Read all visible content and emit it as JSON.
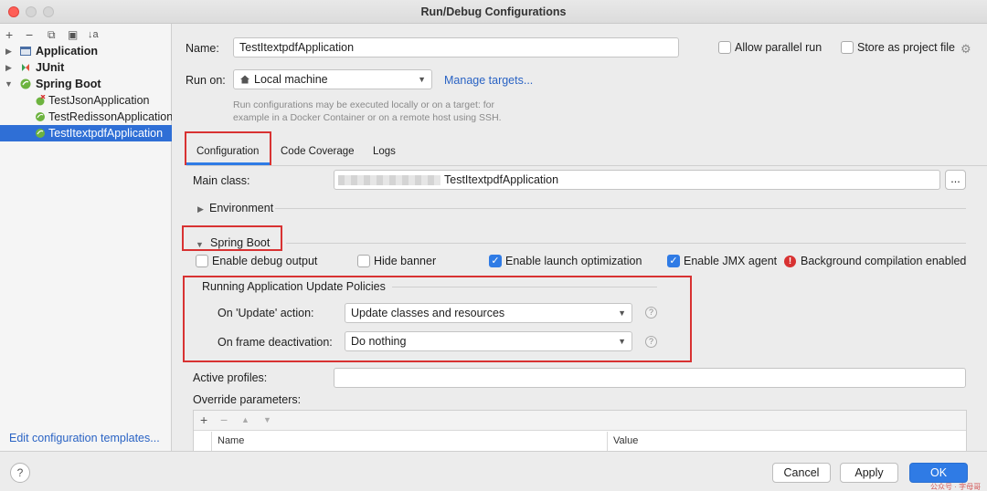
{
  "window": {
    "title": "Run/Debug Configurations"
  },
  "left_toolbar": {
    "add": "+",
    "remove": "−",
    "copy": "⧉",
    "folder": "▣",
    "sort": "↓a"
  },
  "tree": {
    "application": "Application",
    "junit": "JUnit",
    "spring_boot": "Spring Boot",
    "items": [
      "TestJsonApplication",
      "TestRedissonApplication",
      "TestItextpdfApplication"
    ]
  },
  "edit_templates": "Edit configuration templates...",
  "form": {
    "name_label": "Name:",
    "name_value": "TestItextpdfApplication",
    "allow_parallel": "Allow parallel run",
    "store_project": "Store as project file",
    "run_on_label": "Run on:",
    "run_on_value": "Local machine",
    "manage_targets": "Manage targets...",
    "hint": "Run configurations may be executed locally or on a target: for example in a Docker Container or on a remote host using SSH."
  },
  "tabs": [
    "Configuration",
    "Code Coverage",
    "Logs"
  ],
  "config": {
    "main_class_label": "Main class:",
    "main_class_value": "TestItextpdfApplication",
    "browse": "...",
    "environment": "Environment",
    "spring_boot": "Spring Boot",
    "enable_debug": "Enable debug output",
    "hide_banner": "Hide banner",
    "enable_launch": "Enable launch optimization",
    "enable_jmx": "Enable JMX agent",
    "bg_compile": "Background compilation enabled",
    "policies_title": "Running Application Update Policies",
    "on_update_label": "On 'Update' action:",
    "on_update_value": "Update classes and resources",
    "on_frame_label": "On frame deactivation:",
    "on_frame_value": "Do nothing",
    "active_profiles": "Active profiles:",
    "override_params": "Override parameters:",
    "col_name": "Name",
    "col_value": "Value"
  },
  "buttons": {
    "help": "?",
    "cancel": "Cancel",
    "apply": "Apply",
    "ok": "OK"
  },
  "watermark": "公众号 · 字母哥",
  "colors": {
    "accent": "#2f7be5",
    "highlight": "#d83232",
    "selection": "#2f6fd6"
  }
}
